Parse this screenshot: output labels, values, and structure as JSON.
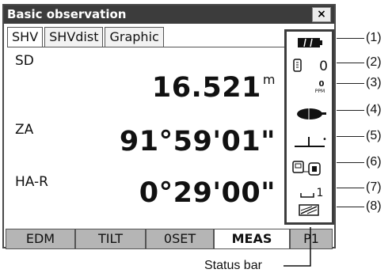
{
  "window": {
    "title": "Basic observation",
    "close_label": "×"
  },
  "tabs": [
    {
      "label": "SHV",
      "active": true
    },
    {
      "label": "SHVdist",
      "active": false
    },
    {
      "label": "Graphic",
      "active": false
    }
  ],
  "measurements": [
    {
      "label": "SD",
      "value": "16.521",
      "unit": "m"
    },
    {
      "label": "ZA",
      "value": "91°59'01\"",
      "unit": ""
    },
    {
      "label": "HA-R",
      "value": "0°29'00\"",
      "unit": ""
    }
  ],
  "softkeys": [
    {
      "label": "EDM",
      "active": false
    },
    {
      "label": "TILT",
      "active": false
    },
    {
      "label": "0SET",
      "active": false
    },
    {
      "label": "MEAS",
      "active": true
    },
    {
      "label": "P1",
      "active": false
    }
  ],
  "status_bar": {
    "prism_constant": "0",
    "ppm_value": "0",
    "ppm_unit": "PPM",
    "comm_channel": "1",
    "icons": [
      "battery-icon",
      "prism-icon",
      "ppm-icon",
      "laser-icon",
      "tilt-icon",
      "communication-icon",
      "input-mode-icon",
      "memory-icon"
    ]
  },
  "callouts": [
    "(1)",
    "(2)",
    "(3)",
    "(4)",
    "(5)",
    "(6)",
    "(7)",
    "(8)"
  ],
  "caption": "Status bar"
}
